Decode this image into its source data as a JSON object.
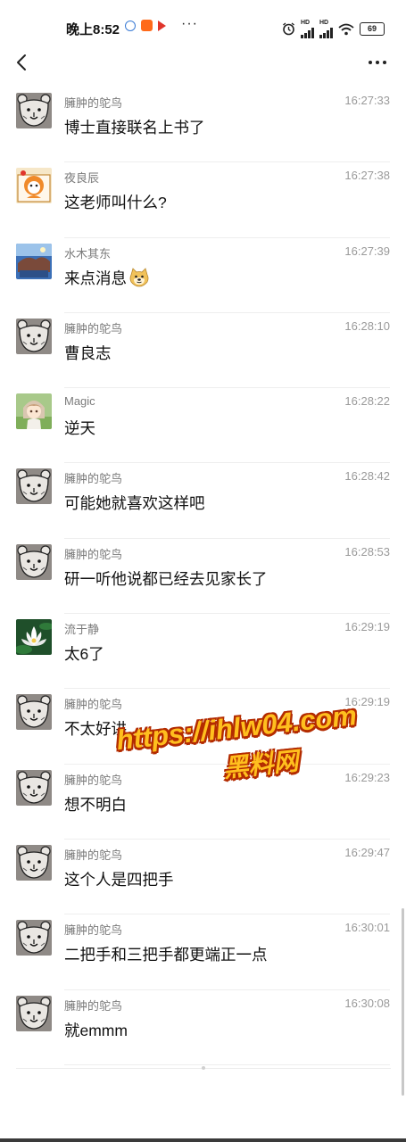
{
  "status_bar": {
    "time": "晚上8:52",
    "dots": "···",
    "battery": "69",
    "hd": "HD"
  },
  "nav": {
    "back_icon": "chevron-left-icon",
    "more_icon": "more-dots-icon"
  },
  "messages": [
    {
      "sender": "臃肿的鸵鸟",
      "time": "16:27:33",
      "text": "博士直接联名上书了",
      "avatar": "bear-sketch"
    },
    {
      "sender": "夜良辰",
      "time": "16:27:38",
      "text": "这老师叫什么?",
      "avatar": "cartoon-orange"
    },
    {
      "sender": "水木其东",
      "time": "16:27:39",
      "text": "来点消息",
      "avatar": "photo-blue",
      "emoji": "doge-emoji"
    },
    {
      "sender": "臃肿的鸵鸟",
      "time": "16:28:10",
      "text": "曹良志",
      "avatar": "bear-sketch"
    },
    {
      "sender": "Magic",
      "time": "16:28:22",
      "text": "逆天",
      "avatar": "anime-girl"
    },
    {
      "sender": "臃肿的鸵鸟",
      "time": "16:28:42",
      "text": "可能她就喜欢这样吧",
      "avatar": "bear-sketch"
    },
    {
      "sender": "臃肿的鸵鸟",
      "time": "16:28:53",
      "text": "研一听他说都已经去见家长了",
      "avatar": "bear-sketch"
    },
    {
      "sender": "流于静",
      "time": "16:29:19",
      "text": "太6了",
      "avatar": "lotus-flower"
    },
    {
      "sender": "臃肿的鸵鸟",
      "time": "16:29:19",
      "text": "不太好讲",
      "avatar": "bear-sketch"
    },
    {
      "sender": "臃肿的鸵鸟",
      "time": "16:29:23",
      "text": "想不明白",
      "avatar": "bear-sketch"
    },
    {
      "sender": "臃肿的鸵鸟",
      "time": "16:29:47",
      "text": "这个人是四把手",
      "avatar": "bear-sketch"
    },
    {
      "sender": "臃肿的鸵鸟",
      "time": "16:30:01",
      "text": "二把手和三把手都更端正一点",
      "avatar": "bear-sketch"
    },
    {
      "sender": "臃肿的鸵鸟",
      "time": "16:30:08",
      "text": "就emmm",
      "avatar": "bear-sketch"
    }
  ],
  "watermark": {
    "line1": "https://ihlw04.com",
    "line2": "黑料网"
  },
  "colors": {
    "sender": "#7a7a7a",
    "time": "#9a9a9a",
    "watermark_fill": "#ffbf1e",
    "watermark_stroke": "#b32b00"
  }
}
